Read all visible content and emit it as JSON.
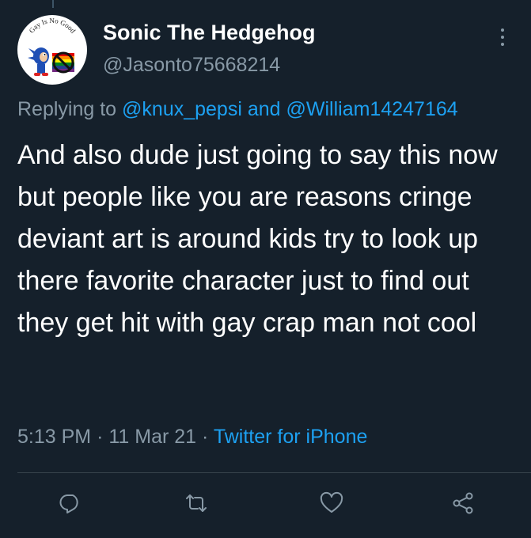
{
  "tweet": {
    "avatar_caption": "Gay Is No Good",
    "display_name": "Sonic The Hedgehog",
    "handle": "@Jasonto75668214",
    "reply_prefix": "Replying to",
    "reply_user_1": "@knux_pepsi",
    "reply_and": "and",
    "reply_user_2": "@William14247164",
    "text": "And also dude just going to say this now but people like you are reasons cringe deviant art is around kids try to look up there favorite character just to find out they get hit with gay crap man not cool",
    "time": "5:13 PM",
    "date": "11 Mar 21",
    "separator": "·",
    "source": "Twitter for iPhone"
  },
  "actions": {
    "reply_icon": "comment-icon",
    "retweet_icon": "retweet-icon",
    "like_icon": "heart-icon",
    "share_icon": "share-icon"
  },
  "colors": {
    "background": "#15202b",
    "primary_text": "#ffffff",
    "secondary_text": "#8899a6",
    "link": "#1da1f2",
    "divider": "#38444d"
  }
}
